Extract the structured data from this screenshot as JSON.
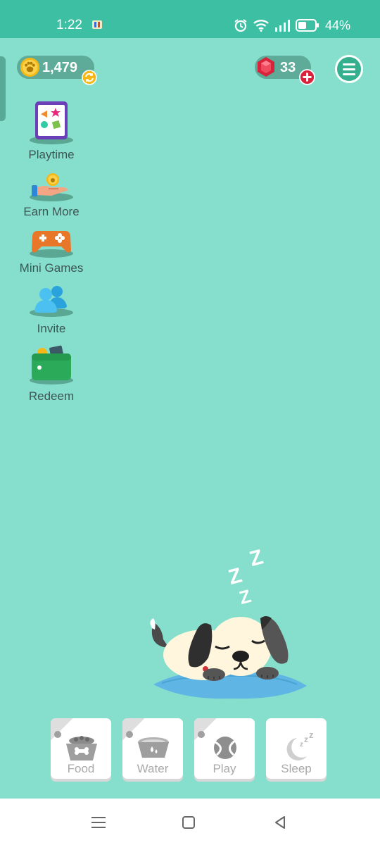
{
  "status_bar": {
    "time": "1:22",
    "battery": "44%"
  },
  "currency": {
    "coins": "1,479",
    "gems": "33"
  },
  "sidebar": {
    "items": [
      {
        "id": "playtime",
        "label": "Playtime",
        "icon": "tablet-shapes-icon"
      },
      {
        "id": "earn-more",
        "label": "Earn More",
        "icon": "hand-coin-icon"
      },
      {
        "id": "mini-games",
        "label": "Mini Games",
        "icon": "gamepad-icon"
      },
      {
        "id": "invite",
        "label": "Invite",
        "icon": "people-icon"
      },
      {
        "id": "redeem",
        "label": "Redeem",
        "icon": "wallet-icon"
      }
    ]
  },
  "pet": {
    "state": "sleeping",
    "zzz": "Z"
  },
  "actions": {
    "food": "Food",
    "water": "Water",
    "play": "Play",
    "sleep": "Sleep"
  },
  "colors": {
    "background": "#86dfcc",
    "status_bar": "#3cbfa2",
    "pill": "#5dab98",
    "label_text": "#3e5555"
  }
}
